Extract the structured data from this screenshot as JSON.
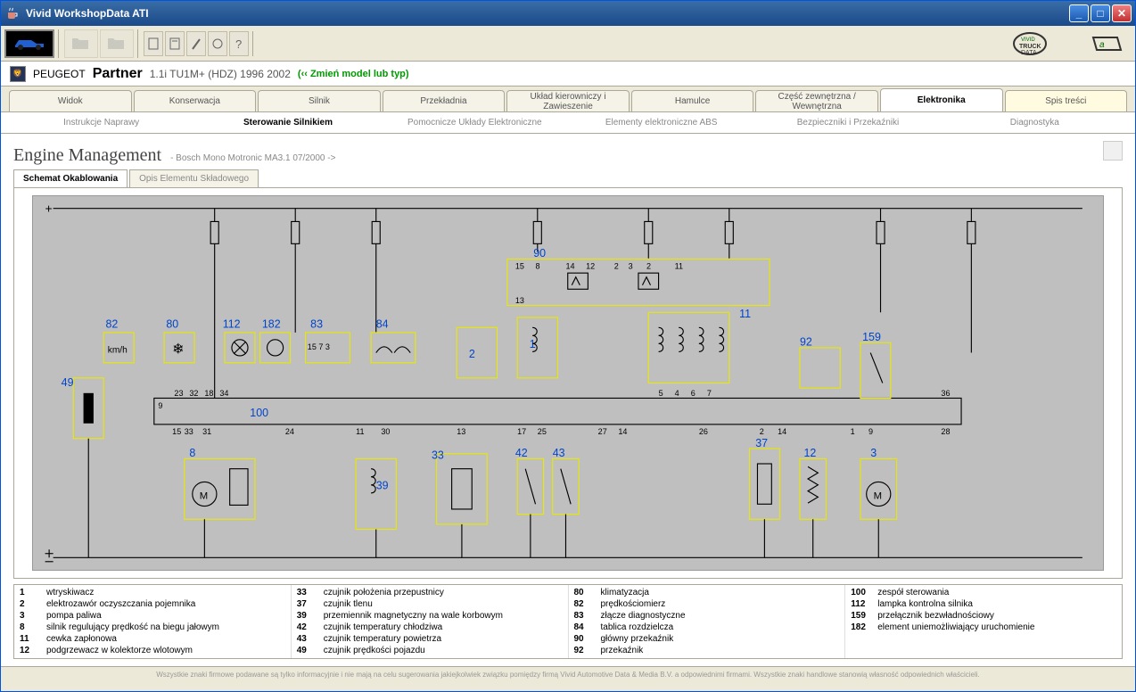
{
  "window": {
    "title": "Vivid WorkshopData ATI"
  },
  "breadcrumb": {
    "brand": "PEUGEOT",
    "model": "Partner",
    "engine": "1.1i TU1M+ (HDZ) 1996 2002",
    "change_link": "(‹‹ Zmień model lub typ)"
  },
  "main_tabs": [
    {
      "label": "Widok"
    },
    {
      "label": "Konserwacja"
    },
    {
      "label": "Silnik"
    },
    {
      "label": "Przekładnia"
    },
    {
      "label": "Układ kierowniczy i Zawieszenie"
    },
    {
      "label": "Hamulce"
    },
    {
      "label": "Część zewnętrzna / Wewnętrzna"
    },
    {
      "label": "Elektronika",
      "active": true
    },
    {
      "label": "Spis treści",
      "hilite": true
    }
  ],
  "sub_tabs": [
    {
      "label": "Instrukcje Naprawy"
    },
    {
      "label": "Sterowanie Silnikiem",
      "active": true
    },
    {
      "label": "Pomocnicze Układy Elektroniczne"
    },
    {
      "label": "Elementy elektroniczne ABS"
    },
    {
      "label": "Bezpieczniki i Przekaźniki"
    },
    {
      "label": "Diagnostyka"
    }
  ],
  "page": {
    "heading": "Engine Management",
    "subheading": "- Bosch Mono Motronic MA3.1 07/2000 ->"
  },
  "doc_tabs": [
    {
      "label": "Schemat Okablowania",
      "active": true
    },
    {
      "label": "Opis Elementu Składowego"
    }
  ],
  "diagram_labels": [
    "82",
    "80",
    "112",
    "182",
    "83",
    "84",
    "49",
    "100",
    "90",
    "11",
    "92",
    "159",
    "8",
    "39",
    "33",
    "42",
    "43",
    "37",
    "12",
    "3"
  ],
  "legend_cols": [
    [
      {
        "num": "1",
        "txt": "wtryskiwacz"
      },
      {
        "num": "2",
        "txt": "elektrozawór oczyszczania pojemnika"
      },
      {
        "num": "3",
        "txt": "pompa paliwa"
      },
      {
        "num": "8",
        "txt": "silnik regulujący prędkość na biegu jałowym"
      },
      {
        "num": "11",
        "txt": "cewka zapłonowa"
      },
      {
        "num": "12",
        "txt": "podgrzewacz w kolektorze wlotowym"
      }
    ],
    [
      {
        "num": "33",
        "txt": "czujnik położenia przepustnicy"
      },
      {
        "num": "37",
        "txt": "czujnik tlenu"
      },
      {
        "num": "39",
        "txt": "przemiennik magnetyczny na wale korbowym"
      },
      {
        "num": "42",
        "txt": "czujnik temperatury chłodziwa"
      },
      {
        "num": "43",
        "txt": "czujnik temperatury powietrza"
      },
      {
        "num": "49",
        "txt": "czujnik prędkości pojazdu"
      }
    ],
    [
      {
        "num": "80",
        "txt": "klimatyzacja"
      },
      {
        "num": "82",
        "txt": "prędkościomierz"
      },
      {
        "num": "83",
        "txt": "złącze diagnostyczne"
      },
      {
        "num": "84",
        "txt": "tablica rozdzielcza"
      },
      {
        "num": "90",
        "txt": "główny przekaźnik"
      },
      {
        "num": "92",
        "txt": "przekaźnik"
      }
    ],
    [
      {
        "num": "100",
        "txt": "zespół sterowania"
      },
      {
        "num": "112",
        "txt": "lampka kontrolna silnika"
      },
      {
        "num": "159",
        "txt": "przełącznik bezwładnościowy"
      },
      {
        "num": "182",
        "txt": "element uniemożliwiający uruchomienie"
      }
    ]
  ],
  "footer": "Wszystkie znaki firmowe podawane są tylko informacyjnie i nie mają na celu sugerowania jakiejkolwiek związku pomiędzy firmą Vivid Automotive Data & Media B.V. a odpowiednimi firmami. Wszystkie znaki handlowe stanowią własność odpowiednich właścicieli."
}
